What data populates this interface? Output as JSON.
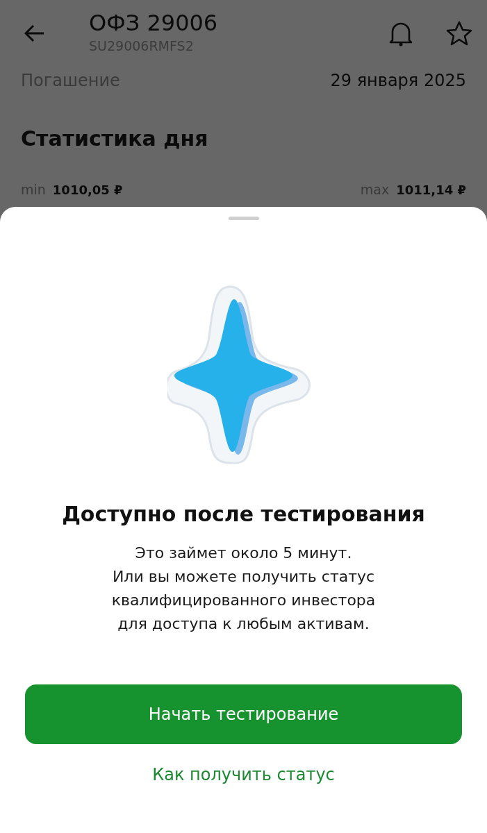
{
  "header": {
    "title": "ОФЗ 29006",
    "subtitle": "SU29006RMFS2"
  },
  "maturity": {
    "label": "Погашение",
    "value": "29 января 2025"
  },
  "section_title": "Статистика дня",
  "day_stats": [
    {
      "label": "min",
      "value": "1010,05 ₽"
    },
    {
      "label": "max",
      "value": "1011,14 ₽"
    }
  ],
  "sheet": {
    "title": "Доступно после тестирования",
    "body": "Это займет около 5 минут.\nИли вы можете получить статус\nквалифицированного инвестора\nдля доступа к любым активам.",
    "primary_button": "Начать тестирование",
    "link": "Как получить статус"
  }
}
